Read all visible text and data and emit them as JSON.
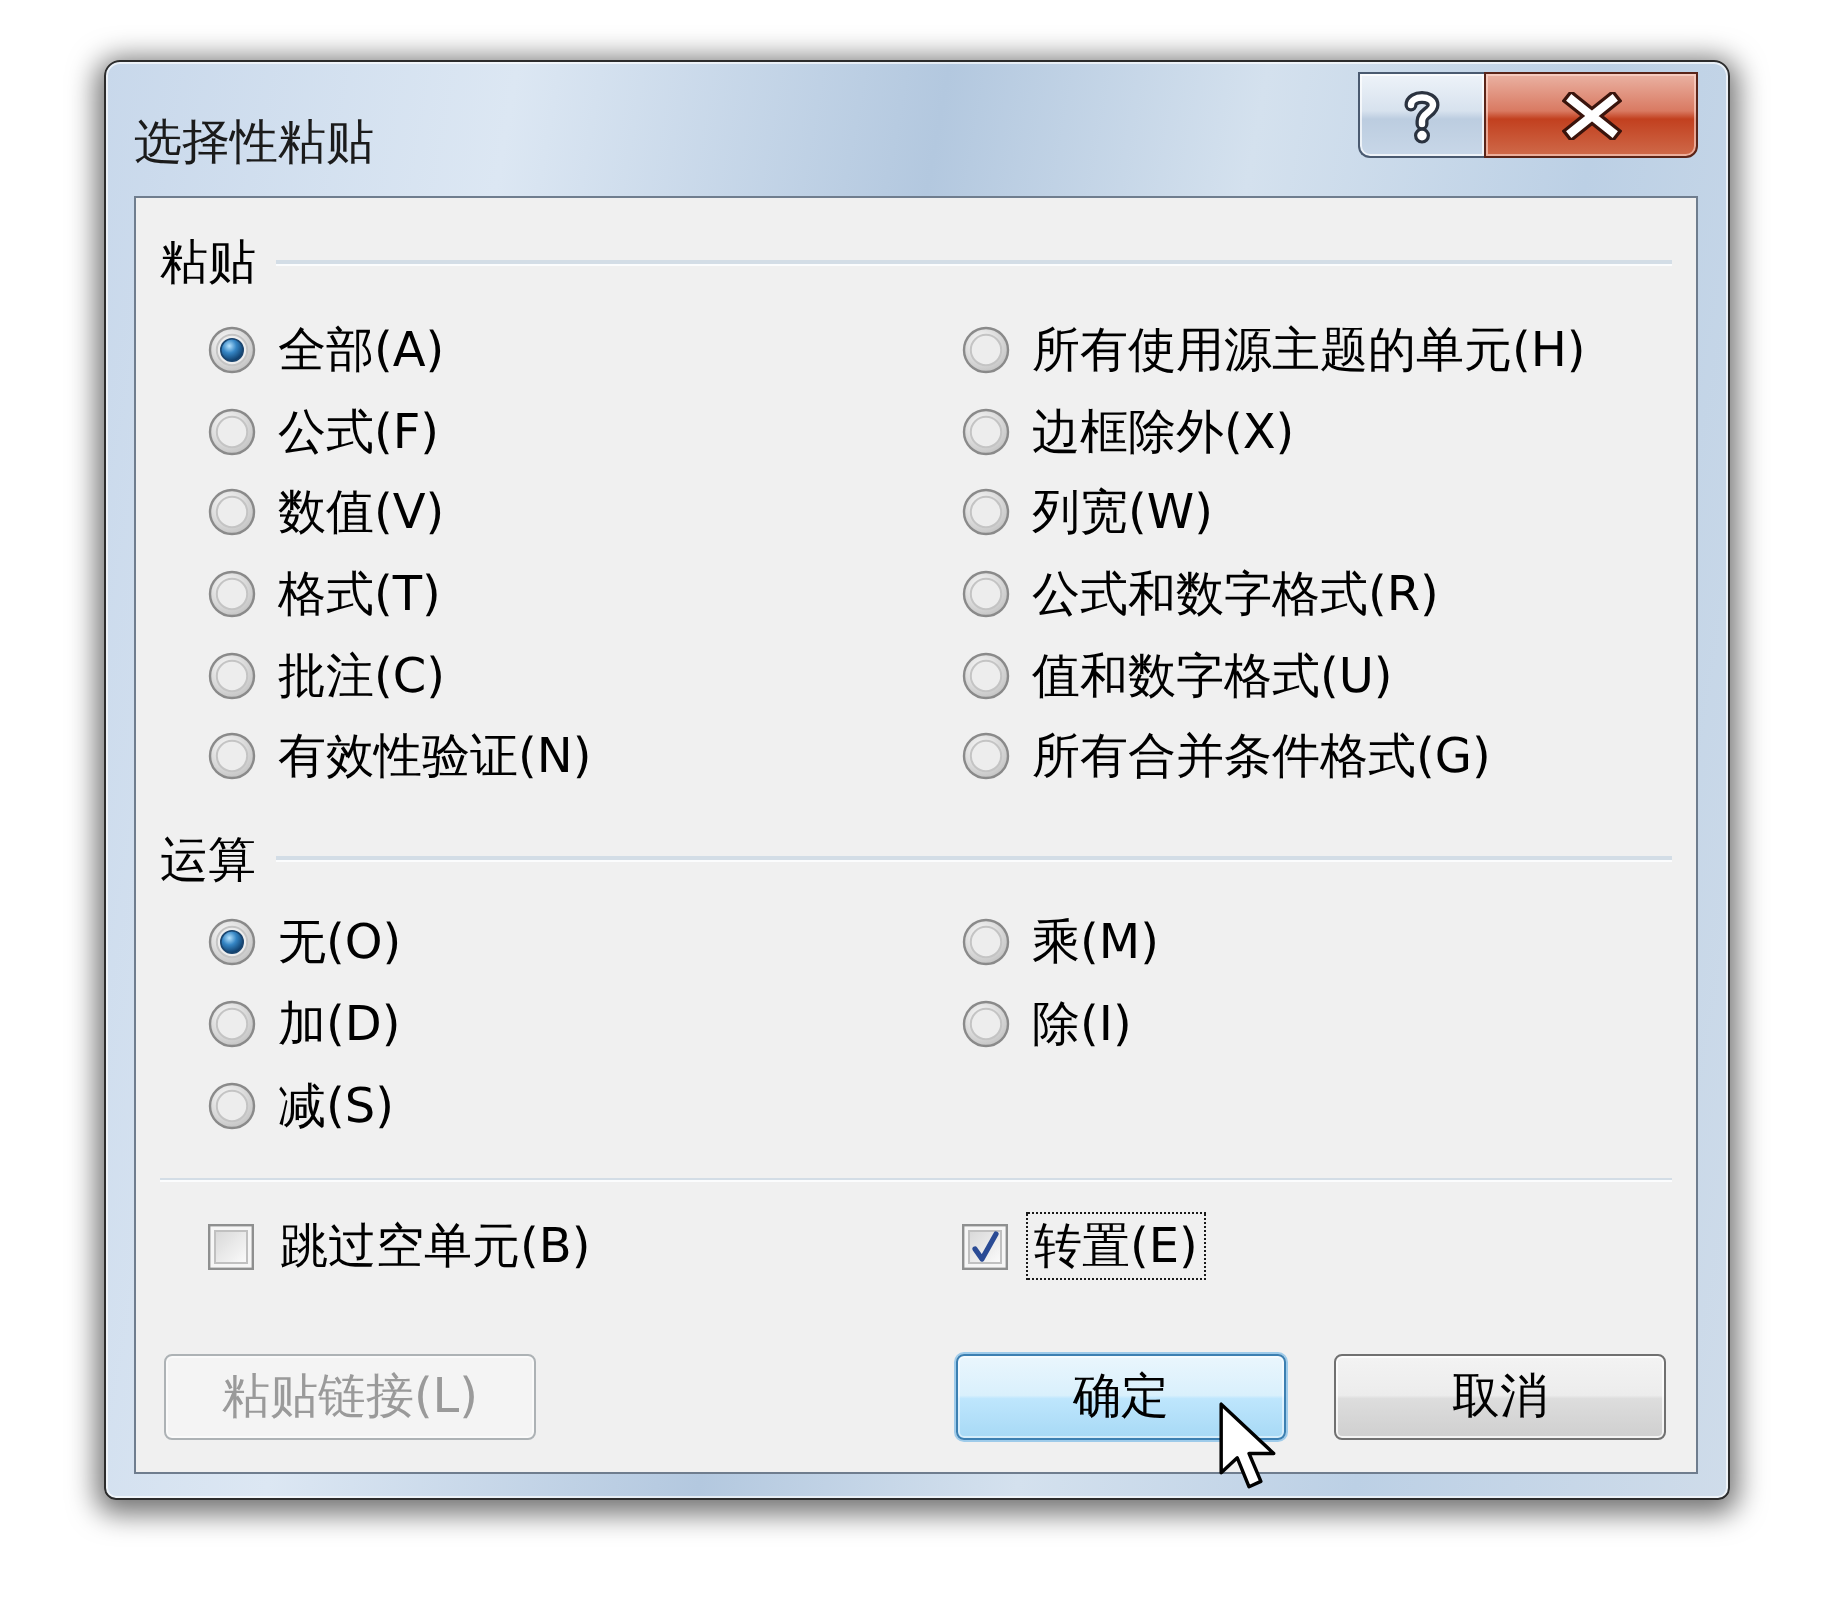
{
  "window": {
    "title": "选择性粘贴"
  },
  "paste": {
    "label": "粘贴",
    "options": [
      {
        "label": "全部(A)",
        "selected": true
      },
      {
        "label": "公式(F)",
        "selected": false
      },
      {
        "label": "数值(V)",
        "selected": false
      },
      {
        "label": "格式(T)",
        "selected": false
      },
      {
        "label": "批注(C)",
        "selected": false
      },
      {
        "label": "有效性验证(N)",
        "selected": false
      },
      {
        "label": "所有使用源主题的单元(H)",
        "selected": false
      },
      {
        "label": "边框除外(X)",
        "selected": false
      },
      {
        "label": "列宽(W)",
        "selected": false
      },
      {
        "label": "公式和数字格式(R)",
        "selected": false
      },
      {
        "label": "值和数字格式(U)",
        "selected": false
      },
      {
        "label": "所有合并条件格式(G)",
        "selected": false
      }
    ]
  },
  "operation": {
    "label": "运算",
    "options": [
      {
        "label": "无(O)",
        "selected": true
      },
      {
        "label": "加(D)",
        "selected": false
      },
      {
        "label": "减(S)",
        "selected": false
      },
      {
        "label": "乘(M)",
        "selected": false
      },
      {
        "label": "除(I)",
        "selected": false
      }
    ]
  },
  "checkboxes": [
    {
      "label": "跳过空单元(B)",
      "checked": false,
      "focused": false
    },
    {
      "label": "转置(E)",
      "checked": true,
      "focused": true
    }
  ],
  "buttons": [
    {
      "label": "粘贴链接(L)",
      "disabled": true,
      "default": false
    },
    {
      "label": "确定",
      "disabled": false,
      "default": true
    },
    {
      "label": "取消",
      "disabled": false,
      "default": false
    }
  ]
}
